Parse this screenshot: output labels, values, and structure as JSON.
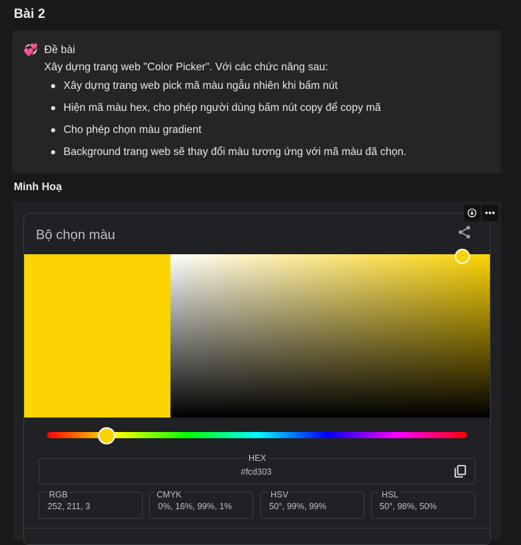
{
  "section_title": "Bài 2",
  "callout": {
    "icon": "💞",
    "title": "Đề bài",
    "description": "Xây dựng trang web \"Color Picker\". Với các chức năng sau:",
    "items": [
      "Xây dựng trang web pick mã màu ngẫu nhiên khi bấm nút",
      "Hiện mã màu hex, cho phép người dùng bấm nút copy để copy mã",
      "Cho phép chọn màu gradient",
      "Background trang web sẽ thay đổi màu tương ứng với mã màu đã chọn."
    ]
  },
  "subsection_title": "Minh Hoạ",
  "picker": {
    "title": "Bộ chọn màu",
    "selected_color": "#fcd303",
    "hex_label": "HEX",
    "hex_value": "#fcd303",
    "rgb_label": "RGB",
    "rgb_value": "252, 211, 3",
    "cmyk_label": "CMYK",
    "cmyk_value": "0%, 16%, 99%, 1%",
    "hsv_label": "HSV",
    "hsv_value": "50°, 99%, 99%",
    "hsl_label": "HSL",
    "hsl_value": "50°, 98%, 50%"
  }
}
